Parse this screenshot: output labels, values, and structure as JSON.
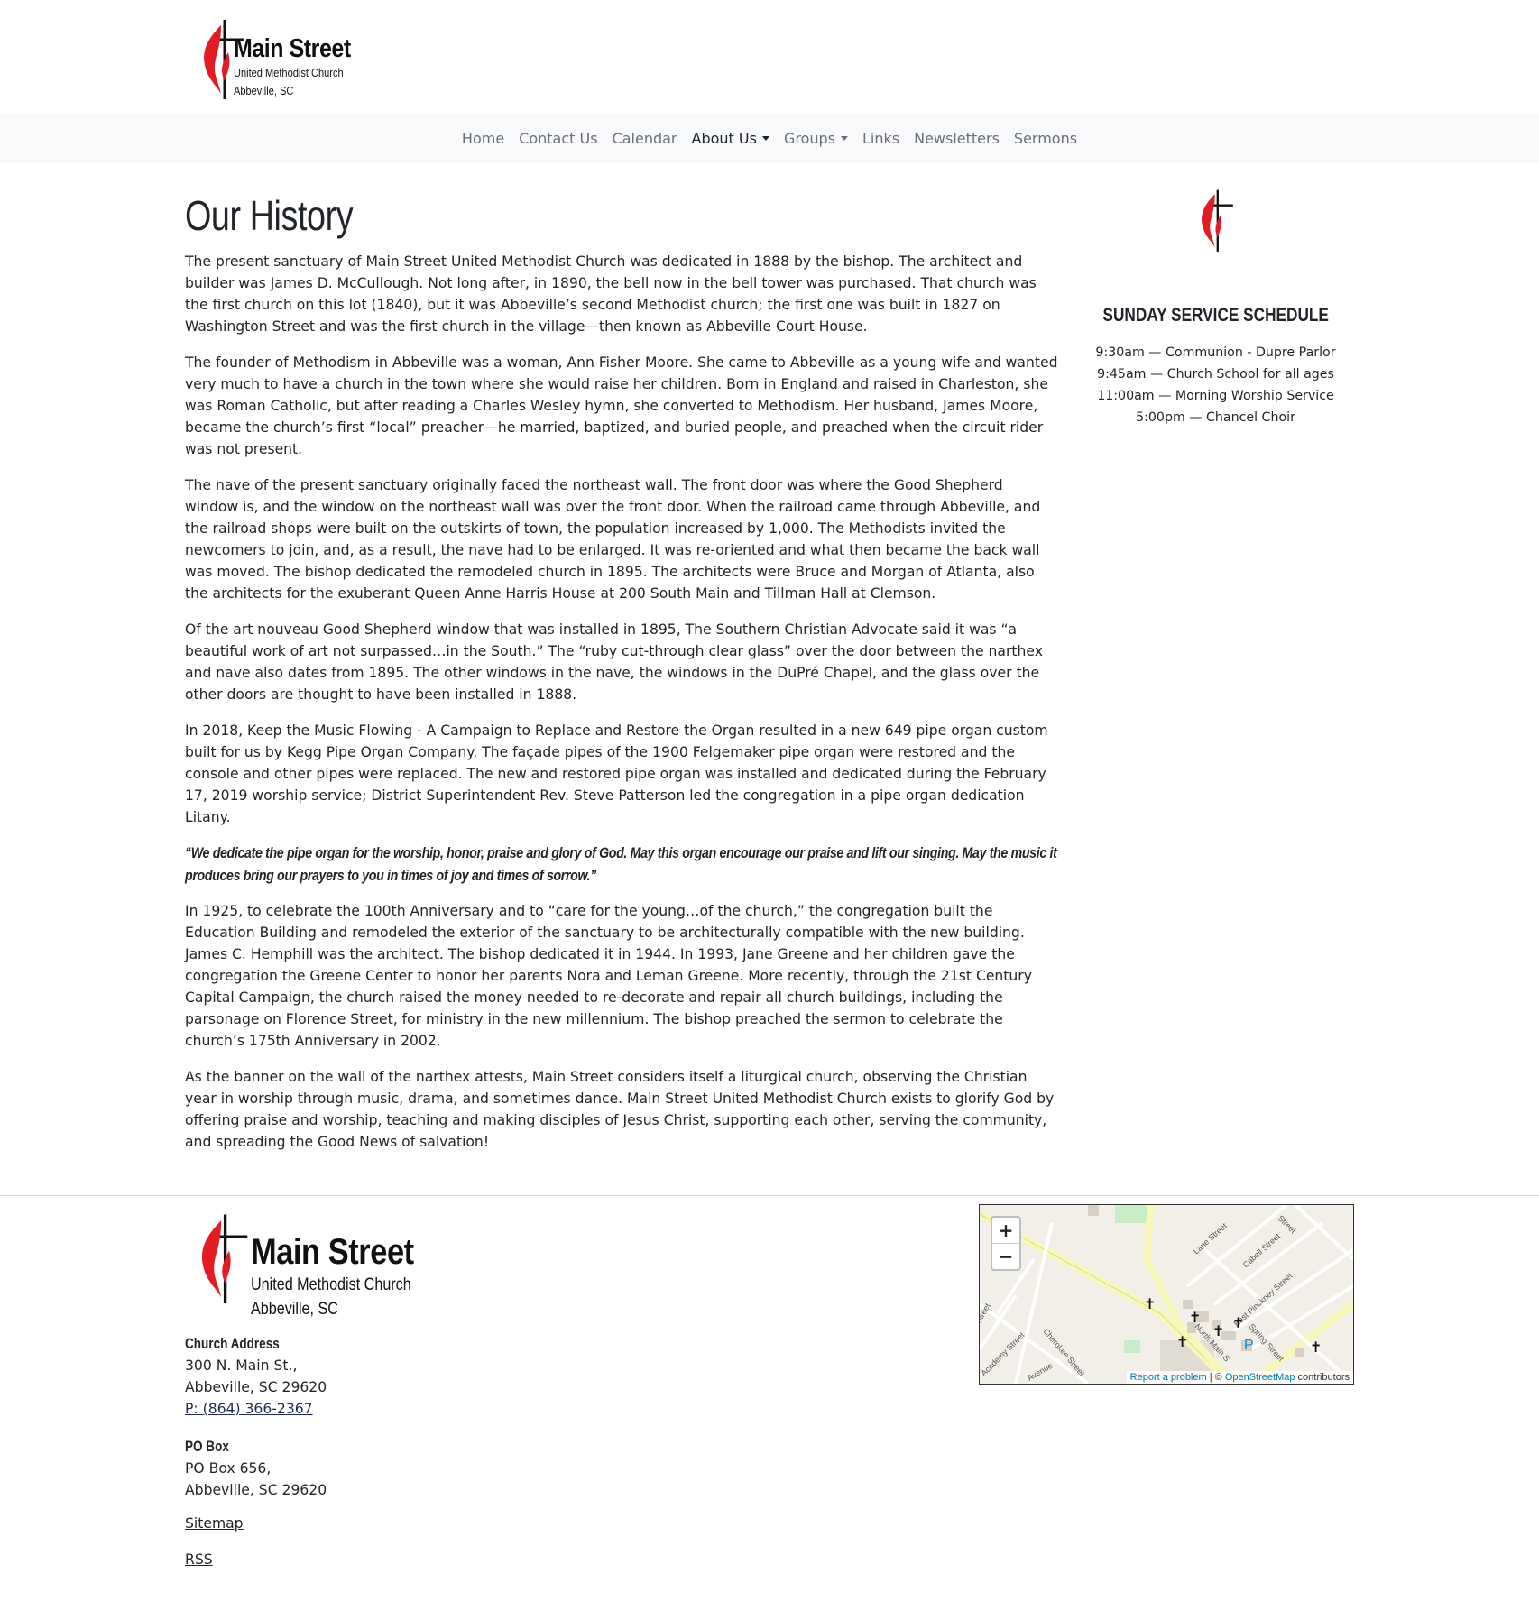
{
  "header": {
    "logo_name": "Main Street",
    "logo_sub": "United Methodist Church",
    "logo_city": "Abbeville, SC"
  },
  "nav": {
    "items": [
      {
        "label": "Home"
      },
      {
        "label": "Contact Us"
      },
      {
        "label": "Calendar"
      },
      {
        "label": "About Us",
        "dropdown": true,
        "active": true
      },
      {
        "label": "Groups",
        "dropdown": true
      },
      {
        "label": "Links"
      },
      {
        "label": "Newsletters"
      },
      {
        "label": "Sermons"
      }
    ]
  },
  "main": {
    "title": "Our History",
    "paragraphs": [
      "The present sanctuary of Main Street United Methodist Church was dedicated in 1888 by the bishop. The architect and builder was James D. McCullough. Not long after, in 1890, the bell now in the bell tower was purchased. That church was the first church on this lot (1840), but it was Abbeville’s second Methodist church; the first one was built in 1827 on Washington Street and was the first church in the village—then known as Abbeville Court House.",
      "The founder of Methodism in Abbeville was a woman, Ann Fisher Moore. She came to Abbeville as a young wife and wanted very much to have a church in the town where she would raise her children. Born in England and raised in Charleston, she was Roman Catholic, but after reading a Charles Wesley hymn, she converted to Methodism. Her husband, James Moore, became the church’s first “local” preacher—he married, baptized, and buried people, and preached when the circuit rider was not present.",
      "The nave of the present sanctuary originally faced the northeast wall. The front door was where the Good Shepherd window is, and the window on the northeast wall was over the front door. When the railroad came through Abbeville, and the railroad shops were built on the outskirts of town, the population increased by 1,000. The Methodists invited the newcomers to join, and, as a result, the nave had to be enlarged. It was re-oriented and what then became the back wall was moved. The bishop dedicated the remodeled church in 1895. The architects were Bruce and Morgan of Atlanta, also the architects for the exuberant Queen Anne Harris House at 200 South Main and Tillman Hall at Clemson.",
      "Of the art nouveau Good Shepherd window that was installed in 1895, The Southern Christian Advocate said it was “a beautiful work of art not surpassed…in the South.” The “ruby cut-through clear glass” over the door between the narthex and nave also dates from 1895. The other windows in the nave, the windows in the DuPré Chapel, and the glass over the other doors are thought to have been installed in 1888.",
      "In 2018, Keep the Music Flowing - A Campaign to Replace and Restore the Organ resulted in a new 649 pipe organ custom built for us by Kegg Pipe Organ Company. The façade pipes of the 1900 Felgemaker pipe organ were restored and the console and other pipes were replaced. The new and restored pipe organ was installed and dedicated during the February 17, 2019 worship service; District Superintendent Rev. Steve Patterson led the congregation in a pipe organ dedication Litany."
    ],
    "quote": "“We dedicate the pipe organ for the worship, honor, praise and glory of God. May this organ encourage our praise and lift our singing. May the music it produces bring our prayers to you in times of joy and times of sorrow.”",
    "paragraphs_after": [
      "In 1925, to celebrate the 100th Anniversary and to “care for the young…of the church,” the congregation built the Education Building and remodeled the exterior of the sanctuary to be architecturally compatible with the new building. James C. Hemphill was the architect. The bishop dedicated it in 1944. In 1993, Jane Greene and her children gave the congregation the Greene Center to honor her parents Nora and Leman Greene. More recently, through the 21st Century Capital Campaign, the church raised the money needed to re-decorate and repair all church buildings, including the parsonage on Florence Street, for ministry in the new millennium. The bishop preached the sermon to celebrate the church’s 175th Anniversary in 2002.",
      "As the banner on the wall of the narthex attests, Main Street considers itself a liturgical church, observing the Christian year in worship through music, drama, and sometimes dance. Main Street United Methodist Church exists to glorify God by offering praise and worship, teaching and making disciples of Jesus Christ, supporting each other, serving the community, and spreading the Good News of salvation!"
    ]
  },
  "sidebar": {
    "heading": "SUNDAY SERVICE SCHEDULE",
    "schedule": [
      "9:30am — Communion - Dupre Parlor",
      "9:45am — Church School for all ages",
      "11:00am — Morning Worship Service",
      "5:00pm — Chancel Choir"
    ]
  },
  "footer": {
    "logo_name": "Main Street",
    "logo_sub": "United Methodist Church",
    "logo_city": "Abbeville, SC",
    "church_address": {
      "heading": "Church Address",
      "line1": "300 N. Main St.,",
      "line2": "Abbeville, SC 29620",
      "phone_prefix": "P: ",
      "phone": "(864) 366-2367"
    },
    "po_box": {
      "heading": "PO Box",
      "line1": "PO Box 656,",
      "line2": "Abbeville, SC 29620"
    },
    "links": {
      "sitemap": "Sitemap",
      "rss": "RSS"
    },
    "map": {
      "zoom_in": "+",
      "zoom_out": "−",
      "report": "Report a problem",
      "sep": " | © ",
      "osm": "OpenStreetMap",
      "contributors": " contributors",
      "street_labels": [
        "Lane Street",
        "Cabell Street",
        "East Pinckney Street",
        "Spring Street",
        "North Main S",
        "Academy Street",
        "Cherokee Street",
        "Avenue",
        "Street",
        "Street",
        "P"
      ]
    }
  },
  "colors": {
    "logo_red": "#e31b23",
    "nav_bg": "#f8f9fa",
    "link_blue": "#0078a8"
  }
}
